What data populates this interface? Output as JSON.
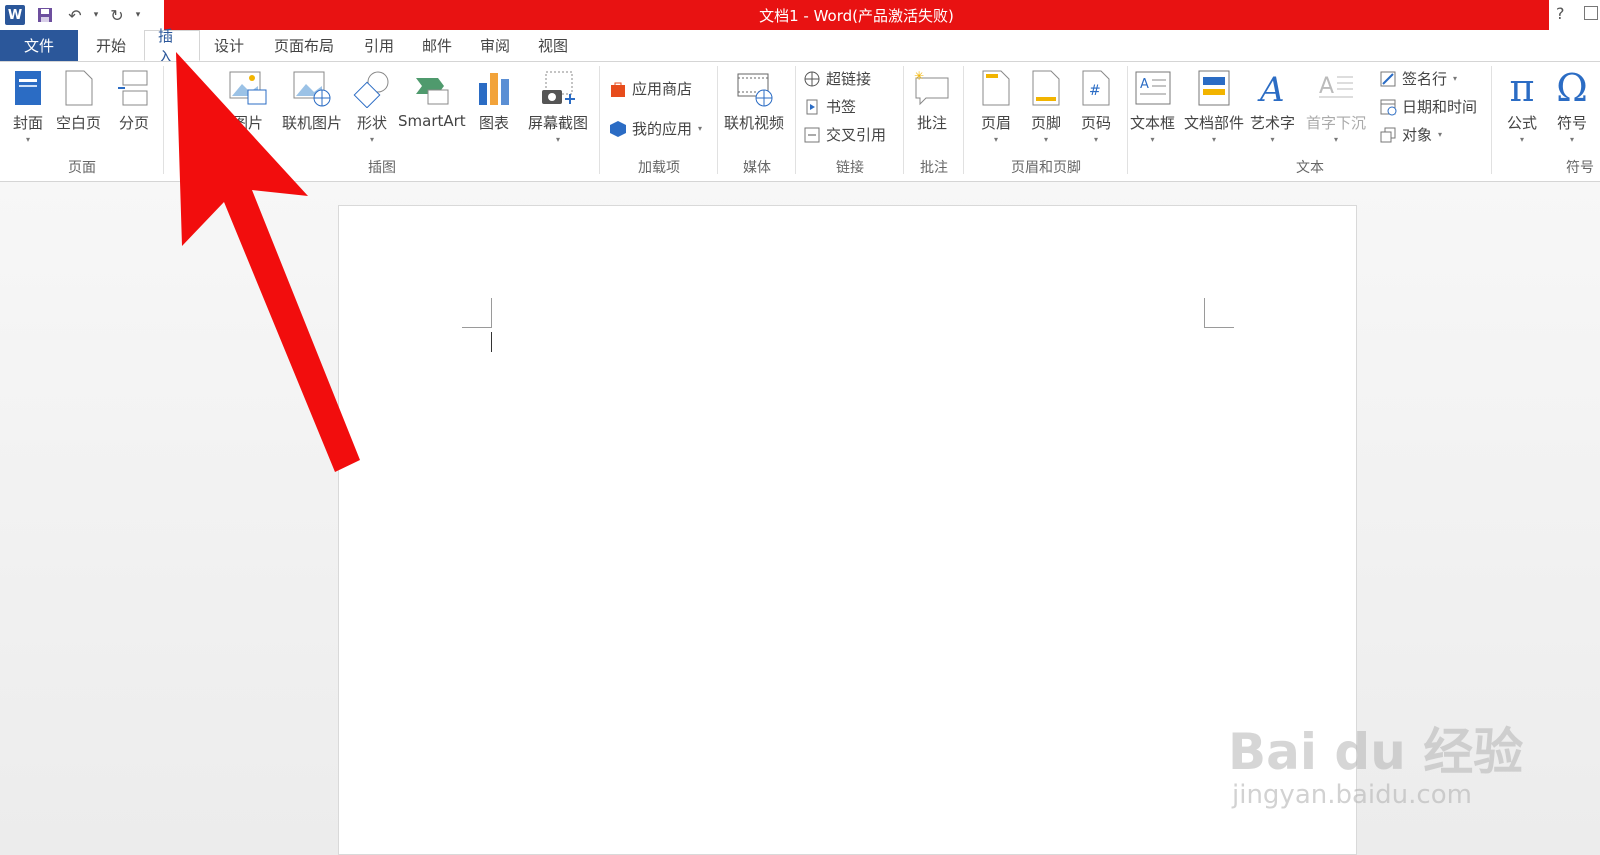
{
  "title_bar": {
    "title": "文档1 -  Word(产品激活失败)",
    "help": "?"
  },
  "tabs": [
    {
      "label": "文件"
    },
    {
      "label": "开始"
    },
    {
      "label": "插入"
    },
    {
      "label": "设计"
    },
    {
      "label": "页面布局"
    },
    {
      "label": "引用"
    },
    {
      "label": "邮件"
    },
    {
      "label": "审阅"
    },
    {
      "label": "视图"
    }
  ],
  "ribbon": {
    "pages": {
      "label": "页面",
      "cover": "封面",
      "blank": "空白页",
      "break": "分页"
    },
    "illustrations": {
      "label": "插图",
      "picture": "图片",
      "online_picture": "联机图片",
      "shapes": "形状",
      "smartart": "SmartArt",
      "chart": "图表",
      "screenshot": "屏幕截图"
    },
    "addins": {
      "label": "加载项",
      "store": "应用商店",
      "my_apps": "我的应用"
    },
    "media": {
      "label": "媒体",
      "online_video": "联机视频"
    },
    "links": {
      "label": "链接",
      "hyperlink": "超链接",
      "bookmark": "书签",
      "cross_ref": "交叉引用"
    },
    "comments": {
      "label": "批注",
      "comment": "批注"
    },
    "header_footer": {
      "label": "页眉和页脚",
      "header": "页眉",
      "footer": "页脚",
      "page_number": "页码"
    },
    "text": {
      "label": "文本",
      "textbox": "文本框",
      "quick_parts": "文档部件",
      "wordart": "艺术字",
      "dropcap": "首字下沉",
      "signature": "签名行",
      "datetime": "日期和时间",
      "object": "对象"
    },
    "symbols": {
      "label": "符号",
      "equation": "公式",
      "symbol": "符号",
      "pi": "π",
      "omega": "Ω"
    }
  },
  "watermark": {
    "brand": "Bai  du 经验",
    "url": "jingyan.baidu.com"
  },
  "colors": {
    "accent": "#2b579a",
    "title_red": "#e81212",
    "arrow_red": "#f20d0d"
  }
}
